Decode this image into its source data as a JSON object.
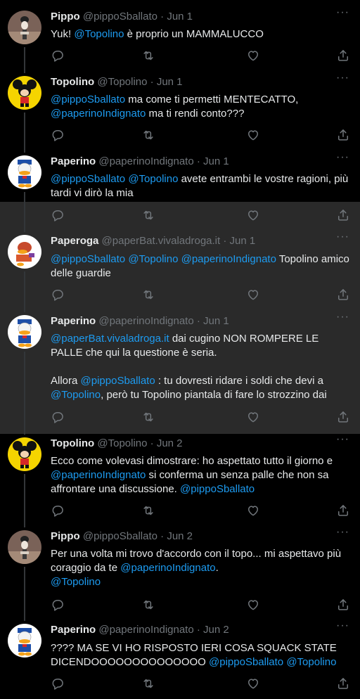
{
  "colors": {
    "background": "#000000",
    "highlight": "#2a2a2a",
    "text": "#e7e9ea",
    "muted": "#71767b",
    "link": "#1d9bf0"
  },
  "icons": {
    "reply": "comment-icon",
    "retweet": "retweet-icon",
    "like": "heart-icon",
    "share": "share-icon",
    "more": "more-dots-icon"
  },
  "tweets": [
    {
      "name": "Pippo",
      "handle": "@pippoSballato",
      "sep": "·",
      "date": "Jun 1",
      "parts": [
        {
          "t": "Yuk! "
        },
        {
          "t": "@Topolino",
          "m": true
        },
        {
          "t": " è proprio un MAMMALUCCO"
        }
      ]
    },
    {
      "name": "Topolino",
      "handle": "@Topolino",
      "sep": "·",
      "date": "Jun 1",
      "parts": [
        {
          "t": "@pippoSballato",
          "m": true
        },
        {
          "t": " ma come ti permetti MENTECATTO, "
        },
        {
          "t": "@paperinoIndignato",
          "m": true
        },
        {
          "t": " ma ti rendi conto???"
        }
      ]
    },
    {
      "name": "Paperino",
      "handle": "@paperinoIndignato",
      "sep": "·",
      "date": "Jun 1",
      "parts": [
        {
          "t": "@pippoSballato",
          "m": true
        },
        {
          "t": " "
        },
        {
          "t": "@Topolino",
          "m": true
        },
        {
          "t": " avete entrambi le vostre ragioni, più tardi vi dirò la mia"
        }
      ]
    },
    {
      "name": "Paperoga",
      "handle": "@paperBat.vivaladroga.it",
      "sep": "·",
      "date": "Jun 1",
      "parts": [
        {
          "t": "@pippoSballato",
          "m": true
        },
        {
          "t": " "
        },
        {
          "t": "@Topolino",
          "m": true
        },
        {
          "t": " "
        },
        {
          "t": "@paperinoIndignato",
          "m": true
        },
        {
          "t": " Topolino amico delle guardie"
        }
      ]
    },
    {
      "name": "Paperino",
      "handle": "@paperinoIndignato",
      "sep": "·",
      "date": "Jun 1",
      "parts": [
        {
          "t": "@paperBat.vivaladroga.it",
          "m": true
        },
        {
          "t": " dai cugino NON ROMPERE LE PALLE che qui la questione è seria."
        },
        {
          "br": true
        },
        {
          "br": true
        },
        {
          "t": "Allora "
        },
        {
          "t": "@pippoSballato",
          "m": true
        },
        {
          "t": " : tu dovresti ridare i soldi che devi a "
        },
        {
          "t": "@Topolino",
          "m": true
        },
        {
          "t": ", però tu Topolino piantala di fare lo strozzino dai"
        }
      ]
    },
    {
      "name": "Topolino",
      "handle": "@Topolino",
      "sep": "·",
      "date": "Jun 2",
      "parts": [
        {
          "t": "Ecco come volevasi dimostrare: ho aspettato tutto il giorno e "
        },
        {
          "t": "@paperinoIndignato",
          "m": true
        },
        {
          "t": " si conferma un senza palle che non sa affrontare una discussione. "
        },
        {
          "t": "@pippoSballato",
          "m": true
        }
      ]
    },
    {
      "name": "Pippo",
      "handle": "@pippoSballato",
      "sep": "·",
      "date": "Jun 2",
      "parts": [
        {
          "t": "Per una volta mi trovo d'accordo con il topo... mi aspettavo più coraggio da te "
        },
        {
          "t": "@paperinoIndignato",
          "m": true
        },
        {
          "t": "."
        },
        {
          "br": true
        },
        {
          "t": "@Topolino",
          "m": true
        }
      ]
    },
    {
      "name": "Paperino",
      "handle": "@paperinoIndignato",
      "sep": "·",
      "date": "Jun 2",
      "parts": [
        {
          "t": "???? MA SE VI HO RISPOSTO IERI COSA SQUACK STATE DICENDOOOOOOOOOOOOOO "
        },
        {
          "t": "@pippoSballato",
          "m": true
        },
        {
          "t": " "
        },
        {
          "t": "@Topolino",
          "m": true
        }
      ]
    }
  ]
}
